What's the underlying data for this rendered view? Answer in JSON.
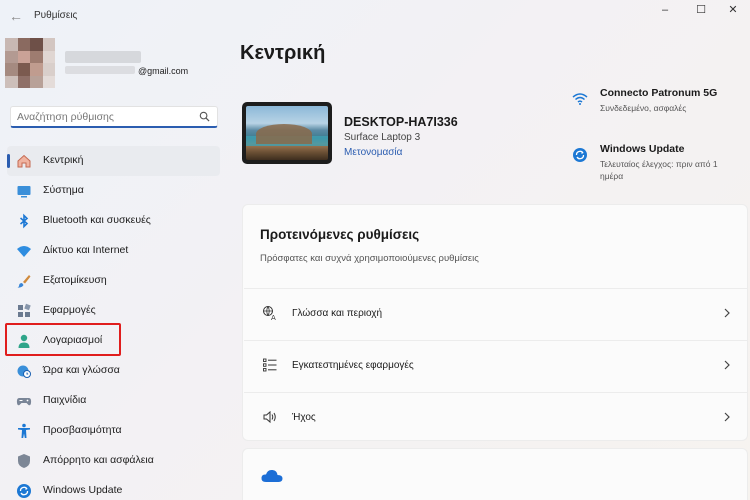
{
  "titlebar": {
    "app_title": "Ρυθμίσεις",
    "back_icon": "←",
    "min_icon": "–",
    "max_icon": "☐",
    "close_icon": "✕"
  },
  "account": {
    "email": "@gmail.com"
  },
  "search": {
    "placeholder": "Αναζήτηση ρύθμισης"
  },
  "sidebar": {
    "items": [
      {
        "label": "Κεντρική",
        "icon": "home-icon",
        "active": true
      },
      {
        "label": "Σύστημα",
        "icon": "system-icon"
      },
      {
        "label": "Bluetooth και συσκευές",
        "icon": "bluetooth-icon"
      },
      {
        "label": "Δίκτυο και Internet",
        "icon": "network-icon"
      },
      {
        "label": "Εξατομίκευση",
        "icon": "brush-icon"
      },
      {
        "label": "Εφαρμογές",
        "icon": "apps-icon"
      },
      {
        "label": "Λογαριασμοί",
        "icon": "person-icon",
        "highlighted": true
      },
      {
        "label": "Ώρα και γλώσσα",
        "icon": "globe-clock-icon"
      },
      {
        "label": "Παιχνίδια",
        "icon": "gamepad-icon"
      },
      {
        "label": "Προσβασιμότητα",
        "icon": "accessibility-icon"
      },
      {
        "label": "Απόρρητο και ασφάλεια",
        "icon": "shield-icon"
      },
      {
        "label": "Windows Update",
        "icon": "update-icon"
      }
    ],
    "highlight_color": "#e01d1d"
  },
  "main": {
    "page_title": "Κεντρική",
    "device": {
      "name": "DESKTOP-HA7I336",
      "model": "Surface Laptop 3",
      "rename": "Μετονομασία"
    },
    "status": [
      {
        "title": "Connecto Patronum 5G",
        "subtitle": "Συνδεδεμένο, ασφαλές",
        "icon": "wifi-icon"
      },
      {
        "title": "Windows Update",
        "subtitle": "Τελευταίος έλεγχος: πριν από 1 ημέρα",
        "icon": "update-icon"
      }
    ],
    "recommended": {
      "title": "Προτεινόμενες ρυθμίσεις",
      "subtitle": "Πρόσφατες και συχνά χρησιμοποιούμενες ρυθμίσεις",
      "rows": [
        {
          "label": "Γλώσσα και περιοχή",
          "icon": "language-icon"
        },
        {
          "label": "Εγκατεστημένες εφαρμογές",
          "icon": "list-icon"
        },
        {
          "label": "Ήχος",
          "icon": "speaker-icon"
        }
      ]
    },
    "onedrive_icon": "cloud-icon"
  },
  "colors": {
    "accent": "#2b5db0",
    "highlight": "#e01d1d"
  }
}
